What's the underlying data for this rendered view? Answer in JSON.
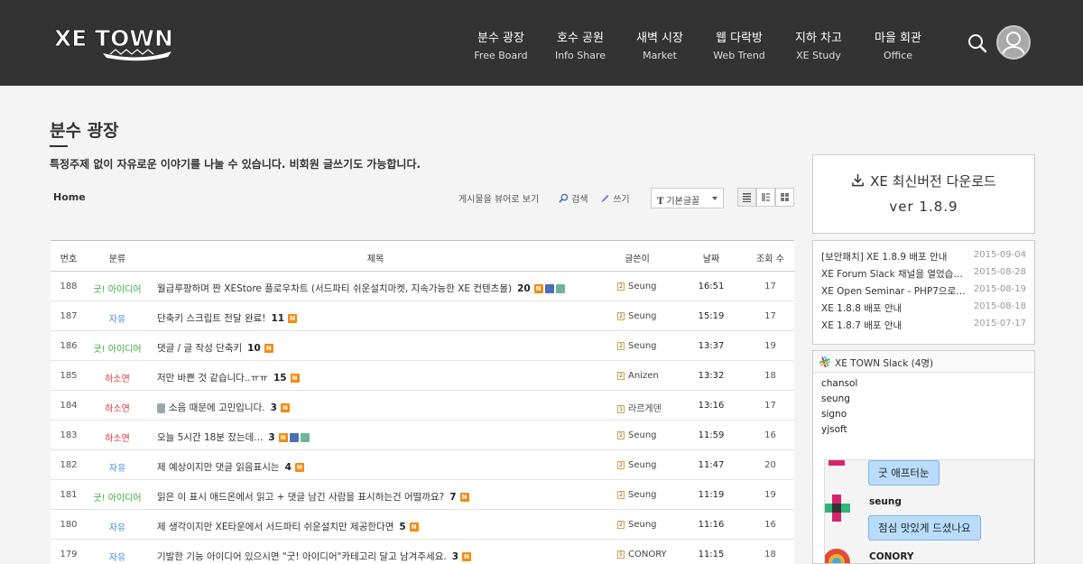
{
  "header": {
    "logo_text": "XE TOWN",
    "nav": [
      {
        "ko": "분수 광장",
        "en": "Free Board"
      },
      {
        "ko": "호수 공원",
        "en": "Info Share"
      },
      {
        "ko": "새벽 시장",
        "en": "Market"
      },
      {
        "ko": "웹 다락방",
        "en": "Web Trend"
      },
      {
        "ko": "지하 차고",
        "en": "XE Study"
      },
      {
        "ko": "마을 회관",
        "en": "Office"
      }
    ]
  },
  "page": {
    "title": "분수 광장",
    "description": "특정주제 없이 자유로운 이야기를 나눌 수 있습니다. 비회원 글쓰기도 가능합니다.",
    "breadcrumb": "Home"
  },
  "toolbar": {
    "collect_label": "게시물을 뷰어로 보기",
    "search_label": "검색",
    "write_label": "쓰기",
    "font_label": "기본글꼴",
    "font_glyph": "T"
  },
  "board": {
    "columns": [
      "번호",
      "분류",
      "제목",
      "글쓴이",
      "날짜",
      "조회 수"
    ],
    "rows": [
      {
        "no": "188",
        "cat": "굿! 아이디어",
        "cat_type": "idea",
        "title": "월급루팡하며 짠 XEStore 플로우차트 (서드파티 쉬운설치마켓, 지속가능한 XE 컨텐츠몰)",
        "comments": "20",
        "extra": "file-img",
        "lvl": "2",
        "author": "Seung",
        "date": "16:51",
        "views": "17"
      },
      {
        "no": "187",
        "cat": "자유",
        "cat_type": "free",
        "title": "단축키 스크립트 전달 완료!",
        "comments": "11",
        "extra": "",
        "lvl": "2",
        "author": "Seung",
        "date": "15:19",
        "views": "17"
      },
      {
        "no": "186",
        "cat": "굿! 아이디어",
        "cat_type": "idea",
        "title": "댓글 / 글 작성 단축키",
        "comments": "10",
        "extra": "",
        "lvl": "2",
        "author": "Seung",
        "date": "13:37",
        "views": "19"
      },
      {
        "no": "185",
        "cat": "하소연",
        "cat_type": "ha",
        "title": "저만 바쁜 것 같습니다..ㅠㅠ",
        "comments": "15",
        "extra": "",
        "lvl": "2",
        "author": "Anizen",
        "date": "13:32",
        "views": "18"
      },
      {
        "no": "184",
        "cat": "하소연",
        "cat_type": "ha",
        "title": "소음 때문에 고민입니다.",
        "comments": "3",
        "extra": "",
        "lvl": "1",
        "author": "라르게덴",
        "date": "13:16",
        "views": "17"
      },
      {
        "no": "183",
        "cat": "하소연",
        "cat_type": "ha",
        "title": "오늘 5시간 18분 잤는데...",
        "comments": "3",
        "extra": "file-img",
        "lvl": "2",
        "author": "Seung",
        "date": "11:59",
        "views": "16"
      },
      {
        "no": "182",
        "cat": "자유",
        "cat_type": "free",
        "title": "제 예상이지만 댓글 읽음표시는",
        "comments": "4",
        "extra": "",
        "lvl": "2",
        "author": "Seung",
        "date": "11:47",
        "views": "20"
      },
      {
        "no": "181",
        "cat": "굿! 아이디어",
        "cat_type": "idea",
        "title": "읽은 이 표시 애드온에서 읽고 + 댓글 남긴 사람을 표시하는건 어떨까요?",
        "comments": "7",
        "extra": "",
        "lvl": "2",
        "author": "Seung",
        "date": "11:19",
        "views": "19"
      },
      {
        "no": "180",
        "cat": "자유",
        "cat_type": "free",
        "title": "제 생각이지만 XE타운에서 서드파티 쉬운설치만 제공한다면",
        "comments": "5",
        "extra": "",
        "lvl": "2",
        "author": "Seung",
        "date": "11:16",
        "views": "16"
      },
      {
        "no": "179",
        "cat": "자유",
        "cat_type": "free",
        "title": "기발한 기능 아이디어 있으시면 \"굿! 아이디어\"카테고리 달고 남겨주세요.",
        "comments": "3",
        "extra": "",
        "lvl": "5",
        "author": "CONORY",
        "date": "11:15",
        "views": "18"
      }
    ],
    "new_badge": "N"
  },
  "sidebar": {
    "download_title": "XE 최신버전 다운로드",
    "download_version": "ver 1.8.9",
    "notices": [
      {
        "title": "[보안패치] XE 1.8.9 배포 안내",
        "date": "2015-09-04"
      },
      {
        "title": "XE Forum Slack 채널을 열었습니다",
        "date": "2015-08-28"
      },
      {
        "title": "XE Open Seminar - PHP7으로 가는 길",
        "date": "2015-08-19"
      },
      {
        "title": "XE 1.8.8 배포 안내",
        "date": "2015-08-18"
      },
      {
        "title": "XE 1.8.7 배포 안내",
        "date": "2015-07-17"
      }
    ],
    "slack": {
      "title": "XE TOWN Slack (4명)",
      "members": [
        "chansol",
        "seung",
        "signo",
        "yjsoft"
      ],
      "messages": [
        {
          "name": "",
          "text": "굿 애프터눈"
        },
        {
          "name": "seung",
          "text": "점심 맛있게 드셨나요"
        },
        {
          "name": "CONORY",
          "text": ""
        }
      ]
    }
  },
  "colors": {
    "header_bg": "#333333",
    "cat_idea": "#3aa83a",
    "cat_free": "#3a8ad8",
    "cat_ha": "#dd3333",
    "badge_new": "#f28b12",
    "bubble": "#b9dcfb"
  }
}
